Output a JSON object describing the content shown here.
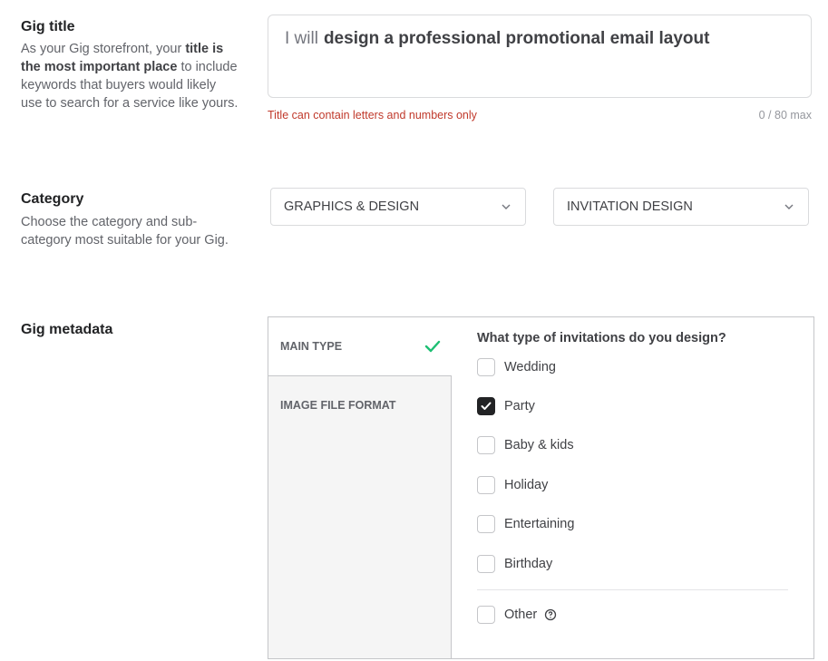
{
  "gig_title": {
    "heading": "Gig title",
    "desc_1": "As your Gig storefront, your ",
    "desc_bold": "title is the most important place",
    "desc_2": " to include keywords that buyers would likely use to search for a service like yours.",
    "prefix": "I will",
    "value": "design a professional promotional email layout",
    "error": "Title can contain letters and numbers only",
    "counter": "0 / 80 max"
  },
  "category": {
    "heading": "Category",
    "desc": "Choose the category and sub-category most suitable for your Gig.",
    "category_value": "GRAPHICS & DESIGN",
    "subcategory_value": "INVITATION DESIGN"
  },
  "metadata": {
    "heading": "Gig metadata",
    "tabs": [
      {
        "label": "MAIN TYPE",
        "complete": true
      },
      {
        "label": "IMAGE FILE FORMAT",
        "complete": false
      }
    ],
    "question": "What type of invitations do you design?",
    "options": [
      {
        "label": "Wedding",
        "checked": false
      },
      {
        "label": "Party",
        "checked": true
      },
      {
        "label": "Baby & kids",
        "checked": false
      },
      {
        "label": "Holiday",
        "checked": false
      },
      {
        "label": "Entertaining",
        "checked": false
      },
      {
        "label": "Birthday",
        "checked": false
      }
    ],
    "other_label": "Other"
  },
  "colors": {
    "error": "#c0392b",
    "check_green": "#1dbf73",
    "checkbox_checked": "#222325"
  },
  "icons": {
    "dropdown": "chevron-down-icon",
    "tab_complete": "checkmark-icon",
    "help": "question-circle-icon"
  }
}
